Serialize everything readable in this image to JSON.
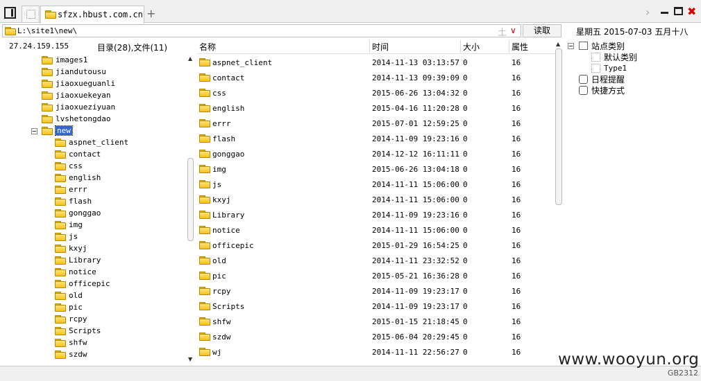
{
  "tabs": {
    "active_label": "sfzx.hbust.com.cn"
  },
  "address": {
    "path": "L:\\site1\\new\\",
    "read_button": "读取"
  },
  "date_bar": "星期五  2015-07-03  五月十八",
  "left_panel": {
    "ip": "27.24.159.155",
    "counts": "目录(28),文件(11)",
    "tree": [
      {
        "label": "images1",
        "level": 1,
        "selected": false,
        "expanded": false
      },
      {
        "label": "jiandutousu",
        "level": 1,
        "selected": false,
        "expanded": false
      },
      {
        "label": "jiaoxueguanli",
        "level": 1,
        "selected": false,
        "expanded": false
      },
      {
        "label": "jiaoxuekeyan",
        "level": 1,
        "selected": false,
        "expanded": false
      },
      {
        "label": "jiaoxueziyuan",
        "level": 1,
        "selected": false,
        "expanded": false
      },
      {
        "label": "lvshetongdao",
        "level": 1,
        "selected": false,
        "expanded": false
      },
      {
        "label": "new",
        "level": 1,
        "selected": true,
        "expanded": true
      },
      {
        "label": "aspnet_client",
        "level": 2,
        "selected": false,
        "expanded": false
      },
      {
        "label": "contact",
        "level": 2,
        "selected": false,
        "expanded": false
      },
      {
        "label": "css",
        "level": 2,
        "selected": false,
        "expanded": false
      },
      {
        "label": "english",
        "level": 2,
        "selected": false,
        "expanded": false
      },
      {
        "label": "errr",
        "level": 2,
        "selected": false,
        "expanded": false
      },
      {
        "label": "flash",
        "level": 2,
        "selected": false,
        "expanded": false
      },
      {
        "label": "gonggao",
        "level": 2,
        "selected": false,
        "expanded": false
      },
      {
        "label": "img",
        "level": 2,
        "selected": false,
        "expanded": false
      },
      {
        "label": "js",
        "level": 2,
        "selected": false,
        "expanded": false
      },
      {
        "label": "kxyj",
        "level": 2,
        "selected": false,
        "expanded": false
      },
      {
        "label": "Library",
        "level": 2,
        "selected": false,
        "expanded": false
      },
      {
        "label": "notice",
        "level": 2,
        "selected": false,
        "expanded": false
      },
      {
        "label": "officepic",
        "level": 2,
        "selected": false,
        "expanded": false
      },
      {
        "label": "old",
        "level": 2,
        "selected": false,
        "expanded": false
      },
      {
        "label": "pic",
        "level": 2,
        "selected": false,
        "expanded": false
      },
      {
        "label": "rcpy",
        "level": 2,
        "selected": false,
        "expanded": false
      },
      {
        "label": "Scripts",
        "level": 2,
        "selected": false,
        "expanded": false
      },
      {
        "label": "shfw",
        "level": 2,
        "selected": false,
        "expanded": false
      },
      {
        "label": "szdw",
        "level": 2,
        "selected": false,
        "expanded": false
      }
    ]
  },
  "file_list": {
    "columns": {
      "name": "名称",
      "time": "时间",
      "size": "大小",
      "attr": "属性"
    },
    "rows": [
      {
        "name": "aspnet_client",
        "time": "2014-11-13 03:13:57",
        "size": "0",
        "attr": "16"
      },
      {
        "name": "contact",
        "time": "2014-11-13 09:39:09",
        "size": "0",
        "attr": "16"
      },
      {
        "name": "css",
        "time": "2015-06-26 13:04:32",
        "size": "0",
        "attr": "16"
      },
      {
        "name": "english",
        "time": "2015-04-16 11:20:28",
        "size": "0",
        "attr": "16"
      },
      {
        "name": "errr",
        "time": "2015-07-01 12:59:25",
        "size": "0",
        "attr": "16"
      },
      {
        "name": "flash",
        "time": "2014-11-09 19:23:16",
        "size": "0",
        "attr": "16"
      },
      {
        "name": "gonggao",
        "time": "2014-12-12 16:11:11",
        "size": "0",
        "attr": "16"
      },
      {
        "name": "img",
        "time": "2015-06-26 13:04:18",
        "size": "0",
        "attr": "16"
      },
      {
        "name": "js",
        "time": "2014-11-11 15:06:00",
        "size": "0",
        "attr": "16"
      },
      {
        "name": "kxyj",
        "time": "2014-11-11 15:06:00",
        "size": "0",
        "attr": "16"
      },
      {
        "name": "Library",
        "time": "2014-11-09 19:23:16",
        "size": "0",
        "attr": "16"
      },
      {
        "name": "notice",
        "time": "2014-11-11 15:06:00",
        "size": "0",
        "attr": "16"
      },
      {
        "name": "officepic",
        "time": "2015-01-29 16:54:25",
        "size": "0",
        "attr": "16"
      },
      {
        "name": "old",
        "time": "2014-11-11 23:32:52",
        "size": "0",
        "attr": "16"
      },
      {
        "name": "pic",
        "time": "2015-05-21 16:36:28",
        "size": "0",
        "attr": "16"
      },
      {
        "name": "rcpy",
        "time": "2014-11-09 19:23:17",
        "size": "0",
        "attr": "16"
      },
      {
        "name": "Scripts",
        "time": "2014-11-09 19:23:17",
        "size": "0",
        "attr": "16"
      },
      {
        "name": "shfw",
        "time": "2015-01-15 21:18:45",
        "size": "0",
        "attr": "16"
      },
      {
        "name": "szdw",
        "time": "2015-06-04 20:29:45",
        "size": "0",
        "attr": "16"
      },
      {
        "name": "wj",
        "time": "2014-11-11 22:56:27",
        "size": "0",
        "attr": "16"
      }
    ]
  },
  "right_panel": {
    "site_category": "站点类别",
    "default_category": "默认类别",
    "type1": "Type1",
    "schedule_reminder": "日程提醒",
    "shortcut": "快捷方式"
  },
  "status": {
    "encoding": "GB2312"
  },
  "watermark": "www.wooyun.org",
  "colors": {
    "selection": "#3366cc",
    "folder": "#f6c21b",
    "close": "#d40000"
  }
}
